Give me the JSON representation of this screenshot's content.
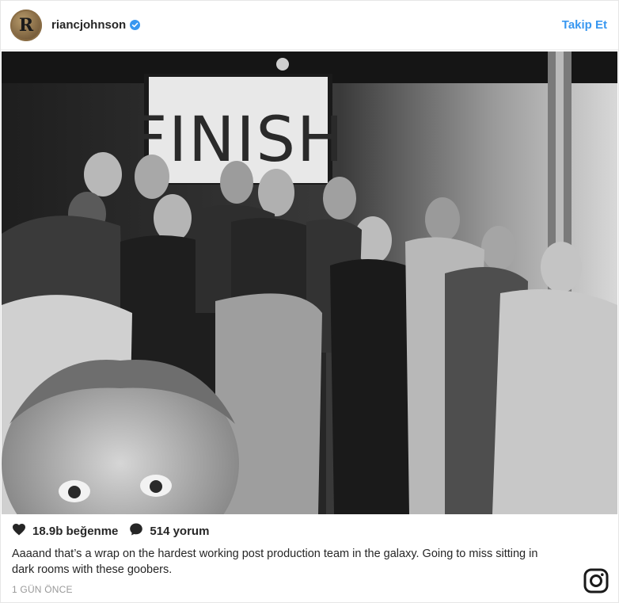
{
  "post": {
    "username": "riancjohnson",
    "avatar_letter": "R",
    "verified_icon": "verified-badge-icon",
    "follow_label": "Takip Et",
    "photo": {
      "description_icon": "group-selfie-photo",
      "sign_text": "FINISH"
    },
    "likes_label": "18.9b beğenme",
    "comments_label": "514 yorum",
    "caption": "Aaaand that’s a wrap on the hardest working post production team in the galaxy. Going to miss sitting in dark rooms with these goobers.",
    "timestamp": "1 GÜN ÖNCE"
  },
  "colors": {
    "accent": "#3897f0",
    "text": "#262626",
    "muted": "#999999"
  },
  "icons": {
    "like": "heart-icon",
    "comment": "comment-bubble-icon",
    "brand": "instagram-logo-icon"
  }
}
